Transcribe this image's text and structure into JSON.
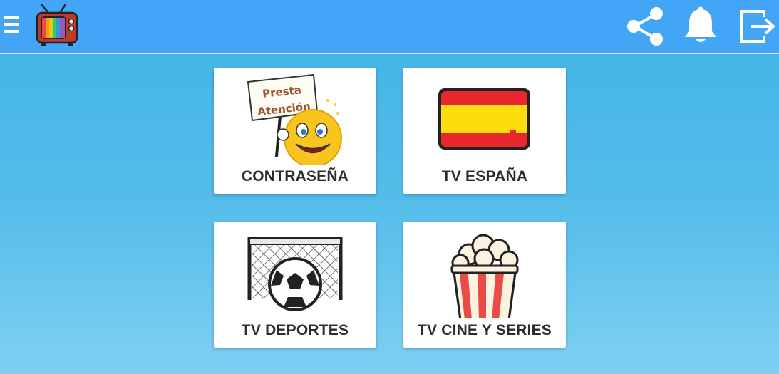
{
  "header": {
    "menu_icon": "hamburger-menu-icon",
    "logo_icon": "retro-tv-logo-icon",
    "actions": [
      {
        "name": "share",
        "icon": "share-icon"
      },
      {
        "name": "notifications",
        "icon": "bell-icon"
      },
      {
        "name": "exit",
        "icon": "exit-icon"
      }
    ],
    "bar_color": "#42a5f5"
  },
  "cards": [
    {
      "label": "CONTRASEÑA",
      "icon": "presta-atencion-smiley-sign-icon",
      "sign_line1": "Presta",
      "sign_line2": "Atención"
    },
    {
      "label": "TV ESPAÑA",
      "icon": "spain-flag-icon"
    },
    {
      "label": "TV DEPORTES",
      "icon": "soccer-goal-ball-icon"
    },
    {
      "label": "TV CINE Y SERIES",
      "icon": "popcorn-icon"
    }
  ]
}
